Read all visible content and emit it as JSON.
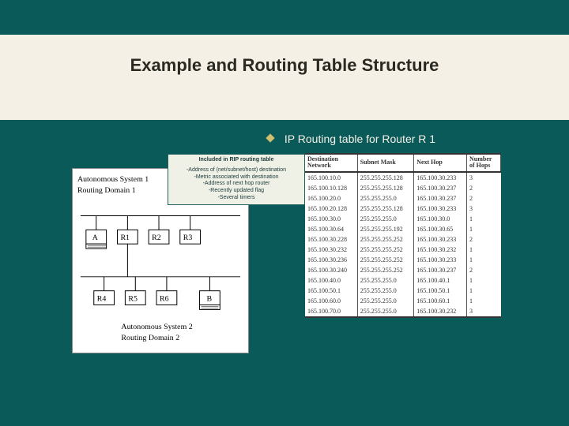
{
  "title": "Example and Routing Table Structure",
  "subtitle": "IP Routing table for Router R 1",
  "rip_box": {
    "header": "Included in RIP routing table",
    "lines": [
      "-Address of (net/subnet/host) destination",
      "-Metric associated with destination",
      "-Address of next hop router",
      "-Recently updated flag",
      "-Several timers"
    ]
  },
  "diagram": {
    "as1": "Autonomous System 1",
    "rd1": "Routing Domain 1",
    "as2": "Autonomous System 2",
    "rd2": "Routing Domain 2",
    "nodes_top": [
      "A",
      "R1",
      "R2",
      "R3"
    ],
    "nodes_bottom": [
      "R4",
      "R5",
      "R6",
      "B"
    ]
  },
  "routing_table": {
    "headers": [
      "Destination\nNetwork",
      "Subnet Mask",
      "Next Hop",
      "Number\nof Hops"
    ],
    "rows": [
      [
        "165.100.10.0",
        "255.255.255.128",
        "165.100.30.233",
        "3"
      ],
      [
        "165.100.10.128",
        "255.255.255.128",
        "165.100.30.237",
        "2"
      ],
      [
        "165.100.20.0",
        "255.255.255.0",
        "165.100.30.237",
        "2"
      ],
      [
        "165.100.20.128",
        "255.255.255.128",
        "165.100.30.233",
        "3"
      ],
      [
        "165.100.30.0",
        "255.255.255.0",
        "165.100.30.0",
        "1"
      ],
      [
        "165.100.30.64",
        "255.255.255.192",
        "165.100.30.65",
        "1"
      ],
      [
        "165.100.30.228",
        "255.255.255.252",
        "165.100.30.233",
        "2"
      ],
      [
        "165.100.30.232",
        "255.255.255.252",
        "165.100.30.232",
        "1"
      ],
      [
        "165.100.30.236",
        "255.255.255.252",
        "165.100.30.233",
        "1"
      ],
      [
        "165.100.30.240",
        "255.255.255.252",
        "165.100.30.237",
        "2"
      ],
      [
        "165.100.40.0",
        "255.255.255.0",
        "165.100.40.1",
        "1"
      ],
      [
        "165.100.50.1",
        "255.255.255.0",
        "165.100.50.1",
        "1"
      ],
      [
        "165.100.60.0",
        "255.255.255.0",
        "165.100.60.1",
        "1"
      ],
      [
        "165.100.70.0",
        "255.255.255.0",
        "165.100.30.232",
        "3"
      ]
    ]
  }
}
